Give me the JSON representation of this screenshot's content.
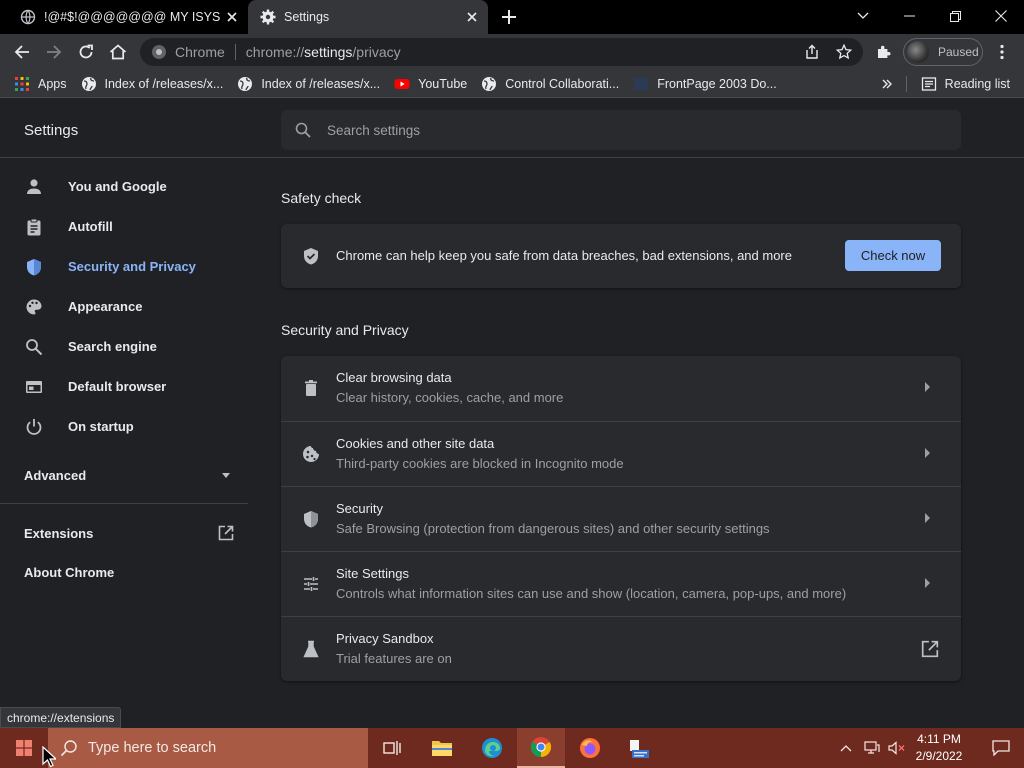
{
  "browser": {
    "tabs": [
      {
        "title": "!@#$!@@@@@@@ MY ISYS PF",
        "icon": "globe-icon",
        "active": false
      },
      {
        "title": "Settings",
        "icon": "gear-icon",
        "active": true
      }
    ],
    "omnibox": {
      "site_label": "Chrome",
      "url_prefix": "chrome://",
      "url_host": "settings",
      "url_path": "/privacy"
    },
    "profile_label": "Paused",
    "bookmarks": [
      {
        "label": "Apps",
        "icon": "apps-grid-icon"
      },
      {
        "label": "Index of /releases/x...",
        "icon": "globe-icon"
      },
      {
        "label": "Index of /releases/x...",
        "icon": "globe-icon"
      },
      {
        "label": "YouTube",
        "icon": "youtube-icon"
      },
      {
        "label": "Control Collaborati...",
        "icon": "globe-icon"
      },
      {
        "label": "FrontPage 2003 Do...",
        "icon": "page-icon"
      }
    ],
    "reading_list_label": "Reading list"
  },
  "settings": {
    "title": "Settings",
    "search_placeholder": "Search settings",
    "nav": [
      {
        "label": "You and Google",
        "icon": "person-icon"
      },
      {
        "label": "Autofill",
        "icon": "clipboard-icon"
      },
      {
        "label": "Security and Privacy",
        "icon": "shield-icon"
      },
      {
        "label": "Appearance",
        "icon": "palette-icon"
      },
      {
        "label": "Search engine",
        "icon": "search-icon"
      },
      {
        "label": "Default browser",
        "icon": "browser-window-icon"
      },
      {
        "label": "On startup",
        "icon": "power-icon"
      }
    ],
    "advanced_label": "Advanced",
    "extensions_label": "Extensions",
    "about_label": "About Chrome",
    "safety_check": {
      "section_title": "Safety check",
      "text": "Chrome can help keep you safe from data breaches, bad extensions, and more",
      "button": "Check now"
    },
    "privacy": {
      "section_title": "Security and Privacy",
      "rows": [
        {
          "title": "Clear browsing data",
          "subtitle": "Clear history, cookies, cache, and more",
          "icon": "trash-icon"
        },
        {
          "title": "Cookies and other site data",
          "subtitle": "Third-party cookies are blocked in Incognito mode",
          "icon": "cookie-icon"
        },
        {
          "title": "Security",
          "subtitle": "Safe Browsing (protection from dangerous sites) and other security settings",
          "icon": "shield-icon"
        },
        {
          "title": "Site Settings",
          "subtitle": "Controls what information sites can use and show (location, camera, pop-ups, and more)",
          "icon": "sliders-icon"
        },
        {
          "title": "Privacy Sandbox",
          "subtitle": "Trial features are on",
          "icon": "flask-icon"
        }
      ]
    }
  },
  "status_url": "chrome://extensions",
  "taskbar": {
    "search_placeholder": "Type here to search",
    "time": "4:11 PM",
    "date": "2/9/2022"
  },
  "colors": {
    "accent": "#8ab4f8",
    "background": "#202124",
    "card": "#292a2d",
    "taskbar": "#6e2a1e"
  }
}
